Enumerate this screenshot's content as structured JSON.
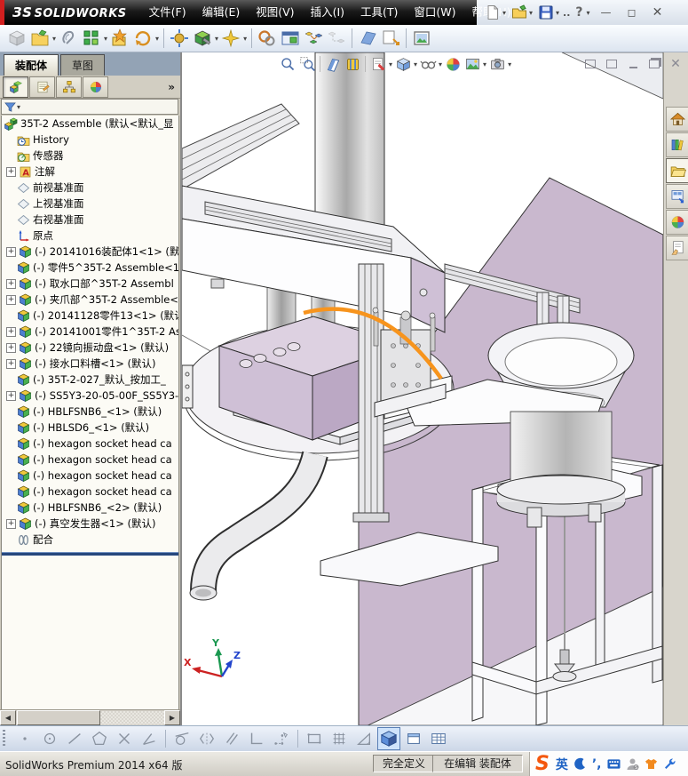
{
  "titlebar": {
    "logo_mark": "ЗS",
    "logo": "SOLIDWORKS",
    "menus": [
      "文件(F)",
      "编辑(E)",
      "视图(V)",
      "插入(I)",
      "工具(T)",
      "窗口(W)",
      "帮助(H)"
    ],
    "more_label": "..",
    "help_label": "?"
  },
  "assembly_toolbar": {
    "items": [
      {
        "icon": "insert-component-icon",
        "disabled": true
      },
      {
        "icon": "open-part-icon",
        "caret": true
      },
      {
        "icon": "mate-clip-icon"
      },
      {
        "icon": "pattern-icon",
        "caret": true
      },
      {
        "icon": "smart-fastener-icon"
      },
      {
        "icon": "rotate-component-icon",
        "caret": true
      },
      "sep",
      {
        "icon": "move-component-icon"
      },
      {
        "icon": "assembly-feature-icon",
        "caret": true
      },
      {
        "icon": "reference-geometry-icon",
        "caret": true
      },
      "sep",
      {
        "icon": "interference-icon"
      },
      {
        "icon": "window-preview-icon"
      },
      {
        "icon": "exploded-view-icon"
      },
      {
        "icon": "explode-line-icon",
        "disabled": true
      },
      "sep",
      {
        "icon": "section-plane-icon"
      },
      {
        "icon": "update-icon"
      },
      "sep",
      {
        "icon": "photo-view-icon"
      }
    ]
  },
  "left_panel": {
    "tabs": [
      {
        "label": "装配体",
        "active": true
      },
      {
        "label": "草图",
        "active": false
      }
    ],
    "manager_tabs": [
      "featuremanager-icon",
      "propertymanager-icon",
      "configurationmanager-icon",
      "displaymanager-icon"
    ],
    "overflow_label": "»",
    "tree": [
      {
        "icon": "assembly-icon",
        "label": "35T-2 Assemble  (默认<默认_显",
        "root": true
      },
      {
        "icon": "history-folder-icon",
        "label": "History"
      },
      {
        "icon": "sensors-folder-icon",
        "label": "传感器"
      },
      {
        "icon": "annotations-folder-icon",
        "label": "注解",
        "expand": true
      },
      {
        "icon": "plane-icon",
        "label": "前视基准面"
      },
      {
        "icon": "plane-icon",
        "label": "上视基准面"
      },
      {
        "icon": "plane-icon",
        "label": "右视基准面"
      },
      {
        "icon": "origin-icon",
        "label": "原点"
      },
      {
        "icon": "part-icon",
        "label": "(-) 20141016装配体1<1> (默",
        "expand": true
      },
      {
        "icon": "part-icon",
        "label": "(-) 零件5^35T-2 Assemble<1"
      },
      {
        "icon": "part-icon",
        "label": "(-) 取水口部^35T-2 Assembl",
        "expand": true
      },
      {
        "icon": "part-icon",
        "label": "(-) 夹爪部^35T-2 Assemble<",
        "expand": true
      },
      {
        "icon": "part-icon",
        "label": "(-) 20141128零件13<1> (默认"
      },
      {
        "icon": "part-icon",
        "label": "(-) 20141001零件1^35T-2 As",
        "expand": true
      },
      {
        "icon": "part-icon",
        "label": "(-) 22镜向振动盘<1> (默认)",
        "expand": true
      },
      {
        "icon": "part-icon",
        "label": "(-) 接水口料槽<1> (默认)",
        "expand": true
      },
      {
        "icon": "part-icon",
        "label": "(-) 35T-2-027_默认_按加工_"
      },
      {
        "icon": "part-icon",
        "label": "(-) SS5Y3-20-05-00F_SS5Y3-",
        "expand": true
      },
      {
        "icon": "part-icon",
        "label": "(-) HBLFSNB6_<1> (默认)"
      },
      {
        "icon": "part-icon",
        "label": "(-) HBLSD6_<1> (默认)"
      },
      {
        "icon": "part-icon",
        "label": "(-) hexagon socket head ca"
      },
      {
        "icon": "part-icon",
        "label": "(-) hexagon socket head ca"
      },
      {
        "icon": "part-icon",
        "label": "(-) hexagon socket head ca"
      },
      {
        "icon": "part-icon",
        "label": "(-) hexagon socket head ca"
      },
      {
        "icon": "part-icon",
        "label": "(-) HBLFSNB6_<2> (默认)"
      },
      {
        "icon": "part-icon",
        "label": "(-) 真空发生器<1> (默认)",
        "expand": true
      },
      {
        "icon": "mates-icon",
        "label": "配合"
      }
    ]
  },
  "viewport": {
    "hud": [
      {
        "icon": "zoom-fit-icon"
      },
      {
        "icon": "zoom-area-icon"
      },
      "sep",
      {
        "icon": "section-view-icon"
      },
      {
        "icon": "clipping-icon"
      },
      "sep",
      {
        "icon": "view-orientation-icon",
        "caret": true
      },
      {
        "icon": "display-style-icon",
        "caret": true
      },
      {
        "icon": "hide-show-icon",
        "caret": true
      },
      {
        "icon": "appearances-icon"
      },
      {
        "icon": "scene-icon",
        "caret": true
      },
      {
        "icon": "camera-icon",
        "caret": true
      }
    ],
    "triad": {
      "x": "X",
      "y": "Y",
      "z": "Z"
    },
    "colors": {
      "highlight_arc": "#F7941D",
      "surface_purple": "#C9B8CE",
      "background": "#FFFFFF",
      "triad_x": "#CC2222",
      "triad_y": "#1A9850",
      "triad_z": "#2244CC"
    }
  },
  "task_pane": {
    "icons": [
      "home-icon",
      "design-library-icon",
      "file-explorer-icon",
      "view-palette-icon",
      "appearances-icon",
      "custom-properties-icon"
    ]
  },
  "sketch_toolbar": {
    "items": [
      {
        "icon": "sk-point-icon"
      },
      {
        "icon": "sk-circle-icon"
      },
      {
        "icon": "sk-line-icon"
      },
      {
        "icon": "sk-polygon-icon"
      },
      {
        "icon": "sk-cross-icon"
      },
      {
        "icon": "sk-angle-icon"
      },
      "sep",
      {
        "icon": "sk-tangent-icon"
      },
      {
        "icon": "sk-mirror-icon"
      },
      {
        "icon": "sk-parallel-icon"
      },
      {
        "icon": "sk-corner-icon"
      },
      {
        "icon": "sk-snap-points-icon"
      },
      "sep",
      {
        "icon": "sk-rect-icon"
      },
      {
        "icon": "sk-grid-icon"
      },
      {
        "icon": "sk-angle-tri-icon"
      },
      {
        "icon": "sk-cube3d-icon",
        "pressed": true
      },
      {
        "icon": "sk-sheet-icon"
      },
      {
        "icon": "sk-table-icon"
      }
    ]
  },
  "statusbar": {
    "app_version": "SolidWorks Premium 2014 x64 版",
    "define_status": "完全定义",
    "edit_status": "在编辑 装配体",
    "ime": {
      "logo": "S",
      "lang": "英",
      "punct": "’,"
    }
  }
}
